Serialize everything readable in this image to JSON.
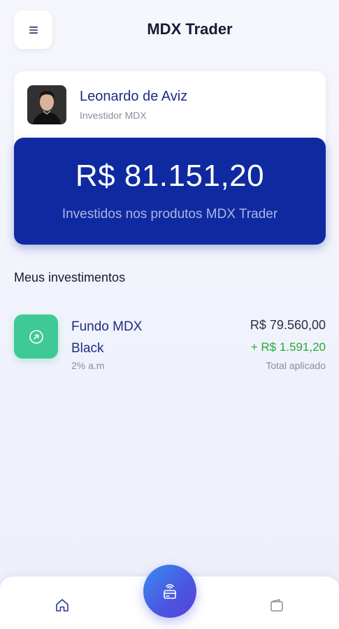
{
  "header": {
    "title": "MDX Trader",
    "menu_icon": "hamburger-menu-icon"
  },
  "profile": {
    "name": "Leonardo de Aviz",
    "role": "Investidor MDX"
  },
  "balance": {
    "amount": "R$ 81.151,20",
    "caption": "Investidos nos produtos MDX Trader",
    "color": "#0f2aa0"
  },
  "investments": {
    "title": "Meus investimentos",
    "items": [
      {
        "name": "Fundo MDX Black",
        "rate": "2% a.m",
        "total": "R$ 79.560,00",
        "gain": "+ R$ 1.591,20",
        "total_label": "Total aplicado",
        "icon": "arrow-up-right-circle-icon",
        "icon_color": "#3fc996",
        "gain_color": "#27a83a"
      }
    ]
  },
  "nav": {
    "home_icon": "home-icon",
    "center_icon": "contactless-card-icon",
    "wallet_icon": "wallet-icon"
  }
}
